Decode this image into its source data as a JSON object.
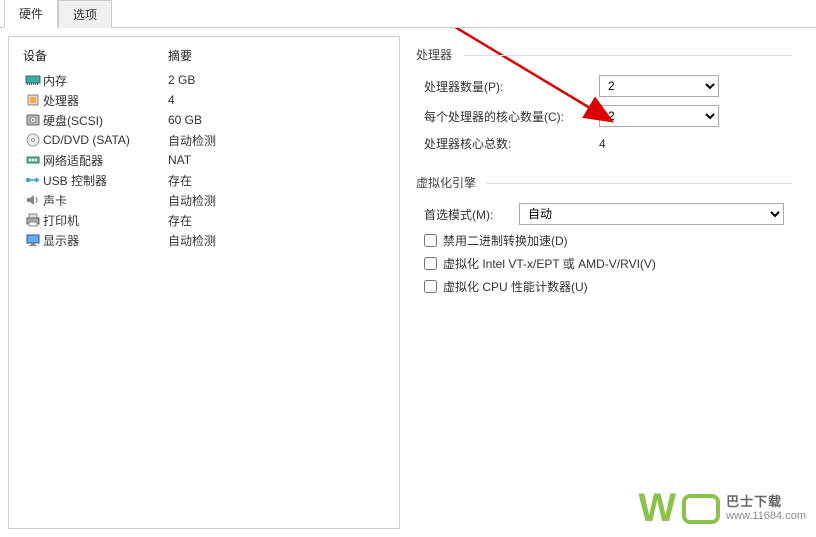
{
  "tabs": {
    "hardware": "硬件",
    "options": "选项"
  },
  "left": {
    "header_device": "设备",
    "header_summary": "摘要",
    "devices": [
      {
        "name": "内存",
        "summary": "2 GB",
        "icon": "memory"
      },
      {
        "name": "处理器",
        "summary": "4",
        "icon": "cpu"
      },
      {
        "name": "硬盘(SCSI)",
        "summary": "60 GB",
        "icon": "disk"
      },
      {
        "name": "CD/DVD (SATA)",
        "summary": "自动检测",
        "icon": "cd"
      },
      {
        "name": "网络适配器",
        "summary": "NAT",
        "icon": "network"
      },
      {
        "name": "USB 控制器",
        "summary": "存在",
        "icon": "usb"
      },
      {
        "name": "声卡",
        "summary": "自动检测",
        "icon": "sound"
      },
      {
        "name": "打印机",
        "summary": "存在",
        "icon": "printer"
      },
      {
        "name": "显示器",
        "summary": "自动检测",
        "icon": "display"
      }
    ]
  },
  "right": {
    "group_processor": "处理器",
    "group_engine": "虚拟化引擎",
    "proc_count_label": "处理器数量(P):",
    "proc_count_value": "2",
    "cores_label": "每个处理器的核心数量(C):",
    "cores_value": "2",
    "total_label": "处理器核心总数:",
    "total_value": "4",
    "mode_label": "首选模式(M):",
    "mode_value": "自动",
    "cb_disable": "禁用二进制转换加速(D)",
    "cb_vt": "虚拟化 Intel VT-x/EPT 或 AMD-V/RVI(V)",
    "cb_perf": "虚拟化 CPU 性能计数器(U)"
  },
  "watermark": {
    "line1": "巴士下载",
    "line2": "www.11684.com"
  }
}
